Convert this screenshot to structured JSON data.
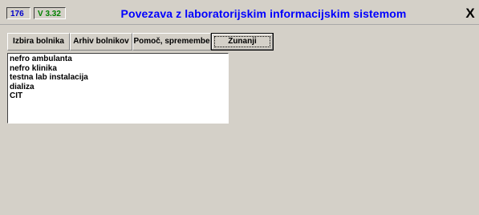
{
  "window": {
    "number_badge": "176",
    "version_badge": "V 3.32",
    "title": "Povezava z laboratorijskim informacijskim sistemom",
    "close_label": "X"
  },
  "tabs": [
    {
      "label": "Izbira bolnika"
    },
    {
      "label": "Arhiv bolnikov"
    },
    {
      "label": "Pomoč, spremembe"
    },
    {
      "label": "Zunanji"
    }
  ],
  "list": {
    "items": [
      {
        "label": "nefro ambulanta"
      },
      {
        "label": "nefro klinika"
      },
      {
        "label": "testna lab instalacija"
      },
      {
        "label": "dializa"
      },
      {
        "label": "CIT"
      }
    ]
  },
  "colors": {
    "title": "#0000ff",
    "number_badge": "#0000cc",
    "version_badge": "#008000",
    "background": "#d4d0c8"
  }
}
